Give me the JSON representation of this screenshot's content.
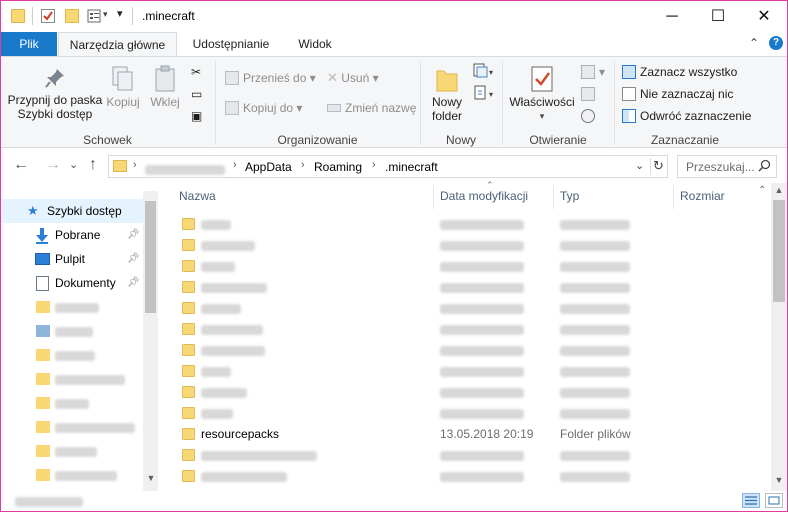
{
  "window": {
    "title": ".minecraft",
    "controls": {
      "minimize": "─",
      "maximize": "☐",
      "close": "✕"
    }
  },
  "tabs": {
    "file": "Plik",
    "items": [
      {
        "label": "Narzędzia główne",
        "active": true
      },
      {
        "label": "Udostępnianie",
        "active": false
      },
      {
        "label": "Widok",
        "active": false
      }
    ],
    "collapse": "⌃",
    "help": "?"
  },
  "ribbon": {
    "clipboard": {
      "label": "Schowek",
      "pin": "Przypnij do paska Szybki dostęp",
      "pin_line1": "Przypnij do paska",
      "pin_line2": "Szybki dostęp",
      "copy": "Kopiuj",
      "paste": "Wklej"
    },
    "organize": {
      "label": "Organizowanie",
      "move_to": "Przenieś do",
      "copy_to": "Kopiuj do",
      "delete": "Usuń",
      "rename": "Zmień nazwę"
    },
    "new": {
      "label": "Nowy",
      "new_folder_line1": "Nowy",
      "new_folder_line2": "folder"
    },
    "open": {
      "label": "Otwieranie",
      "properties": "Właściwości"
    },
    "select": {
      "label": "Zaznaczanie",
      "select_all": "Zaznacz wszystko",
      "select_none": "Nie zaznaczaj nic",
      "invert": "Odwróć zaznaczenie"
    }
  },
  "address": {
    "crumbs": [
      "AppData",
      "Roaming",
      ".minecraft"
    ],
    "search_placeholder": "Przeszukaj...",
    "refresh": "↻",
    "dropdown": "⌄"
  },
  "navigation": {
    "back": "←",
    "forward": "→",
    "recent": "⌄",
    "up": "↑"
  },
  "nav_pane": {
    "items": [
      {
        "label": "Szybki dostęp",
        "icon": "star-icon",
        "selected": true
      },
      {
        "label": "Pobrane",
        "icon": "download-icon",
        "pinned": true
      },
      {
        "label": "Pulpit",
        "icon": "desktop-icon",
        "pinned": true
      },
      {
        "label": "Dokumenty",
        "icon": "documents-icon",
        "pinned": true
      }
    ]
  },
  "columns": {
    "name": "Nazwa",
    "date": "Data modyfikacji",
    "type": "Typ",
    "size": "Rozmiar"
  },
  "files": [
    {
      "name": "resourcepacks",
      "date": "13.05.2018 20:19",
      "type": "Folder plików"
    }
  ],
  "colors": {
    "accent": "#1979ca",
    "folder": "#f8d775",
    "window_border": "#e63aa3"
  }
}
